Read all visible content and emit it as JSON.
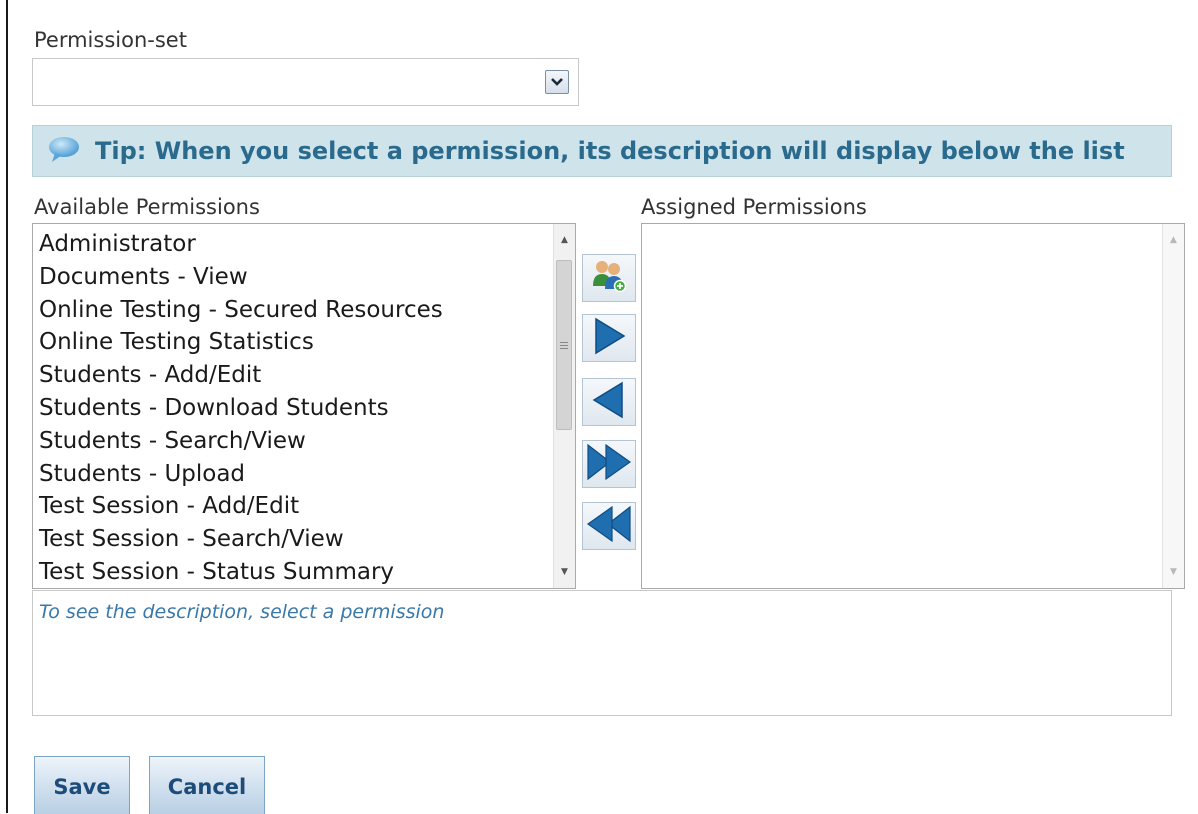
{
  "permission_set": {
    "label": "Permission-set",
    "selected_value": ""
  },
  "tip": {
    "text": "Tip: When you select a permission, its description will display below the list",
    "icon": "speech-bubble-icon"
  },
  "available": {
    "label": "Available Permissions",
    "items": [
      "Administrator",
      "Documents - View",
      "Online Testing - Secured Resources",
      "Online Testing Statistics",
      "Students - Add/Edit",
      "Students - Download Students",
      "Students - Search/View",
      "Students - Upload",
      "Test Session - Add/Edit",
      "Test Session - Search/View",
      "Test Session - Status Summary"
    ]
  },
  "assigned": {
    "label": "Assigned Permissions",
    "items": []
  },
  "move_buttons": [
    {
      "name": "assign-role-icon"
    },
    {
      "name": "move-right-icon"
    },
    {
      "name": "move-left-icon"
    },
    {
      "name": "move-all-right-icon"
    },
    {
      "name": "move-all-left-icon"
    }
  ],
  "description": {
    "placeholder": "To see the description, select a permission"
  },
  "buttons": {
    "save": "Save",
    "cancel": "Cancel"
  },
  "colors": {
    "tip_background": "#cfe3ea",
    "tip_text": "#2a6a8c",
    "arrow_blue": "#1f6fb0",
    "description_text": "#3a78a8",
    "button_text": "#1e4c7a"
  }
}
